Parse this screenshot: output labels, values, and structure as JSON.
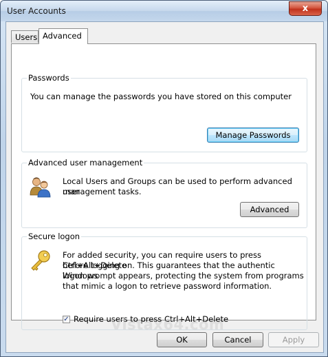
{
  "window": {
    "title": "User Accounts",
    "close_glyph": "x"
  },
  "tabs": [
    {
      "label": "Users",
      "active": false
    },
    {
      "label": "Advanced",
      "active": true
    }
  ],
  "passwords": {
    "title": "Passwords",
    "description": "You can manage the passwords you have stored on this computer",
    "button_label": "Manage Passwords"
  },
  "advanced_management": {
    "title": "Advanced user management",
    "description_line1": "Local Users and Groups can be used to perform advanced user",
    "description_line2": "management tasks.",
    "button_label": "Advanced",
    "icon": "users-icon"
  },
  "secure_logon": {
    "title": "Secure logon",
    "lines": [
      "For added security, you can require users to press Ctrl+Alt+Delete",
      "before logging on. This guarantees that the authentic Windows",
      "logon prompt appears, protecting the system from programs",
      "that mimic a logon to retrieve password information."
    ],
    "checkbox_label": "Require users to press Ctrl+Alt+Delete",
    "checkbox_checked": true,
    "icon": "key-icon"
  },
  "footer": {
    "ok_label": "OK",
    "cancel_label": "Cancel",
    "apply_label": "Apply",
    "apply_enabled": false
  },
  "watermark": "Vistax64.com",
  "colors": {
    "close_button": "#c0321c",
    "default_button_border": "#3c7fb1"
  }
}
